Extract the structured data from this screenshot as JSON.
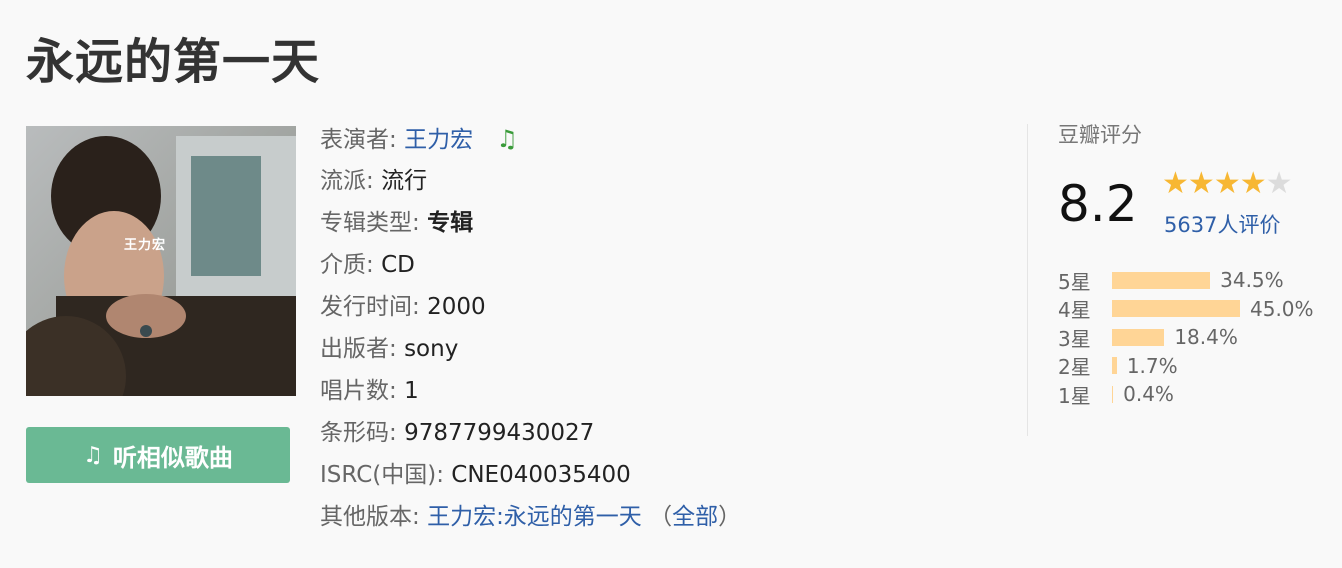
{
  "album": {
    "title": "永远的第一天",
    "cover_text": "王力宏"
  },
  "similar_button": {
    "icon": "music-note-icon",
    "label": "听相似歌曲"
  },
  "info": {
    "performer_label": "表演者:",
    "performer_value": "王力宏",
    "performer_icon": "music-note-icon",
    "genre_label": "流派:",
    "genre_value": "流行",
    "type_label": "专辑类型:",
    "type_value": "专辑",
    "medium_label": "介质:",
    "medium_value": "CD",
    "release_label": "发行时间:",
    "release_value": "2000",
    "publisher_label": "出版者:",
    "publisher_value": "sony",
    "discs_label": "唱片数:",
    "discs_value": "1",
    "barcode_label": "条形码:",
    "barcode_value": "9787799430027",
    "isrc_label": "ISRC(中国):",
    "isrc_value": "CNE040035400",
    "versions_label": "其他版本:",
    "versions_link": "王力宏:永远的第一天",
    "versions_open": "（",
    "versions_all": "全部",
    "versions_close": "）"
  },
  "rating": {
    "label": "豆瓣评分",
    "score": "8.2",
    "stars_filled": 4,
    "stars_total": 5,
    "votes": "5637人评价",
    "accent_color": "#f7b733",
    "bar_color": "#ffd596",
    "distribution": [
      {
        "label": "5星",
        "percent": 34.5,
        "text": "34.5%"
      },
      {
        "label": "4星",
        "percent": 45.0,
        "text": "45.0%"
      },
      {
        "label": "3星",
        "percent": 18.4,
        "text": "18.4%"
      },
      {
        "label": "2星",
        "percent": 1.7,
        "text": "1.7%"
      },
      {
        "label": "1星",
        "percent": 0.4,
        "text": "0.4%"
      }
    ]
  }
}
